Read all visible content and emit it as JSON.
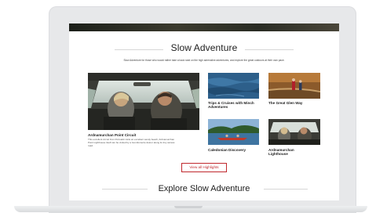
{
  "page": {
    "section_title": "Slow Adventure",
    "intro": "Slow Adventure for those who would rather take a back seat on the high adrenaline adventures, and explore the great outdoors at their own pace.",
    "featured": {
      "title": "Ardnamurchan Point Circuit",
      "description_line1": "This excellent circuit from Portuairk visits an excellent sandy beach, Ardnamurchan",
      "description_line2": "Point Lighthouse itself can be visited by a two kilometre detour along its tiny access",
      "description_line3": "road."
    },
    "cards": [
      {
        "title_line1": "Trips & Cruises with Minch",
        "title_line2": "Adventures"
      },
      {
        "title_line1": "The Great Glen Way",
        "title_line2": ""
      },
      {
        "title_line1": "Caledonian Discovery",
        "title_line2": ""
      },
      {
        "title_line1": "Ardnamurchan",
        "title_line2": "Lighthouse"
      }
    ],
    "view_all_label": "View all Highlights",
    "explore_title": "Explore Slow Adventure"
  },
  "colors": {
    "accent": "#c0282d",
    "text": "#1d1d1d",
    "bezel": "#e7e8ea"
  }
}
